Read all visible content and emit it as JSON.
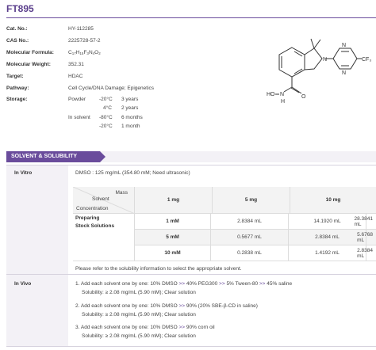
{
  "product": {
    "name": "FT895"
  },
  "properties": [
    {
      "key": "Cat. No.:",
      "value": "HY-112285"
    },
    {
      "key": "CAS No.:",
      "value": "2225728-57-2"
    },
    {
      "key": "Molecular Formula:",
      "value": "C₁₇H₁₅F₃N₄O₂"
    },
    {
      "key": "Molecular Weight:",
      "value": "352.31"
    },
    {
      "key": "Target:",
      "value": "HDAC"
    },
    {
      "key": "Pathway:",
      "value": "Cell Cycle/DNA Damage; Epigenetics"
    },
    {
      "key": "Storage:",
      "value": ""
    }
  ],
  "formula_parts": {
    "c": "C",
    "c_n": "17",
    "h": "H",
    "h_n": "15",
    "f": "F",
    "f_n": "3",
    "n": "N",
    "n_n": "4",
    "o": "O",
    "o_n": "2"
  },
  "storage": [
    {
      "form": "Powder",
      "temp": "-20°C",
      "duration": "3 years"
    },
    {
      "form": "",
      "temp": "4°C",
      "duration": "2 years"
    },
    {
      "form": "In solvent",
      "temp": "-80°C",
      "duration": "6 months"
    },
    {
      "form": "",
      "temp": "-20°C",
      "duration": "1 month"
    }
  ],
  "structure_labels": {
    "hydroxyl": "HO",
    "amide_n": "N",
    "amide_h": "H",
    "oxygen": "O",
    "ring_n": "N",
    "pyr_n1": "N",
    "pyr_n2": "N",
    "cf3": "CF₃"
  },
  "section": {
    "title": "SOLVENT & SOLUBILITY"
  },
  "in_vitro": {
    "label": "In Vitro",
    "solubility": "DMSO : 125 mg/mL (354.80 mM; Need ultrasonic)",
    "table": {
      "corner_mass": "Mass",
      "corner_solvent": "Solvent",
      "corner_concentration": "Concentration",
      "row_group_label_1": "Preparing",
      "row_group_label_2": "Stock Solutions",
      "columns": [
        "1 mg",
        "5 mg",
        "10 mg"
      ],
      "rows": [
        {
          "conc": "1 mM",
          "values": [
            "2.8384 mL",
            "14.1920 mL",
            "28.3841 mL"
          ]
        },
        {
          "conc": "5 mM",
          "values": [
            "0.5677 mL",
            "2.8384 mL",
            "5.6768 mL"
          ]
        },
        {
          "conc": "10 mM",
          "values": [
            "0.2838 mL",
            "1.4192 mL",
            "2.8384 mL"
          ]
        }
      ]
    },
    "note": "Please refer to the solubility information to select the appropriate solvent."
  },
  "in_vivo": {
    "label": "In Vivo",
    "protocols": [
      {
        "line1_pre": "1. Add each solvent one by one:  10% DMSO ",
        "line1_arrow1": ">>",
        "line1_mid1": " 40% PEG300 ",
        "line1_arrow2": ">>",
        "line1_mid2": " 5% Tween-80 ",
        "line1_arrow3": ">>",
        "line1_end": " 45% saline",
        "line2": "Solubility: ≥ 2.08 mg/mL (5.90 mM); Clear solution"
      },
      {
        "line1_pre": "2. Add each solvent one by one:  10% DMSO ",
        "line1_arrow1": ">>",
        "line1_mid1": " 90% (20% SBE-β-CD in saline)",
        "line1_arrow2": "",
        "line1_mid2": "",
        "line1_arrow3": "",
        "line1_end": "",
        "line2": "Solubility: ≥ 2.08 mg/mL (5.90 mM); Clear solution"
      },
      {
        "line1_pre": "3. Add each solvent one by one:  10% DMSO ",
        "line1_arrow1": ">>",
        "line1_mid1": " 90% corn oil",
        "line1_arrow2": "",
        "line1_mid2": "",
        "line1_arrow3": "",
        "line1_end": "",
        "line2": "Solubility: ≥ 2.08 mg/mL (5.90 mM); Clear solution"
      }
    ]
  },
  "colors": {
    "brand": "#6a4c9c",
    "band": "#f3f1f6"
  }
}
